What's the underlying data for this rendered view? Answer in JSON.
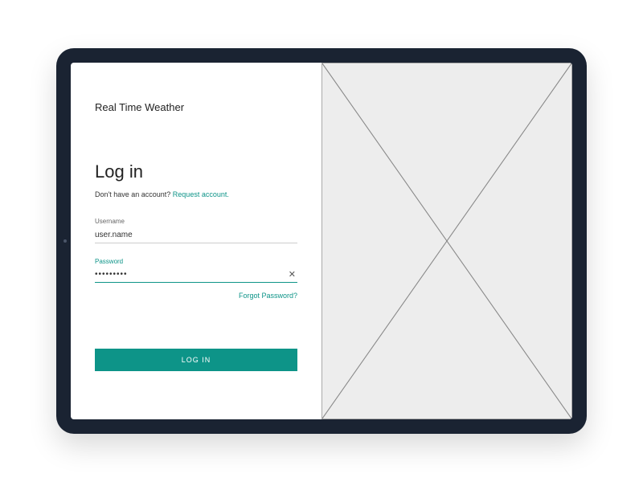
{
  "app": {
    "title": "Real Time Weather"
  },
  "login": {
    "heading": "Log in",
    "prompt_text": "Don't have an account? ",
    "request_link": "Request account.",
    "username_label": "Username",
    "username_value": "user.name",
    "password_label": "Password",
    "password_value": "•••••••••",
    "forgot_link": "Forgot Password?",
    "button_label": "LOG IN"
  },
  "colors": {
    "accent": "#0d9488"
  }
}
